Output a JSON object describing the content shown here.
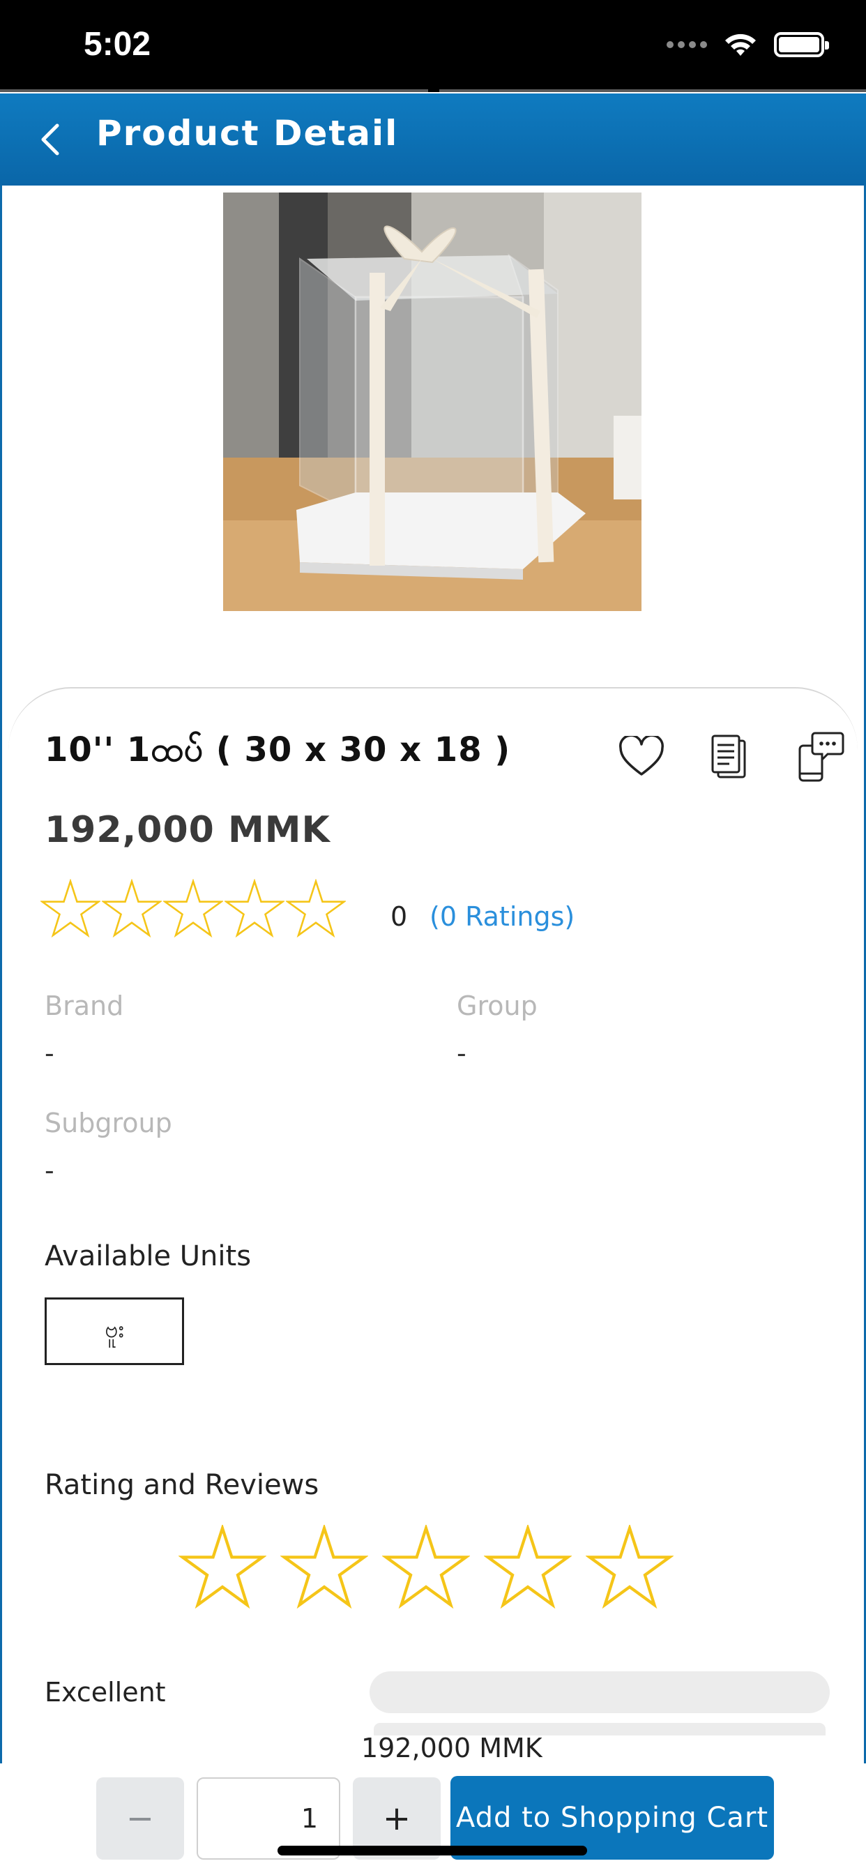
{
  "status_bar": {
    "time": "5:02"
  },
  "header": {
    "title": "Product Detail",
    "back_icon": "chevron-left-icon"
  },
  "product": {
    "name": "10'' 1ထပ် ( 30 x 30 x 18 )",
    "price": "192,000 MMK",
    "image_description_icon": "product-image",
    "rating_value": 0,
    "rating_count": "0",
    "ratings_link": "(0 Ratings)",
    "stars_total": 5
  },
  "actions": {
    "favorite_icon": "heart-icon",
    "document_icon": "document-icon",
    "chat_icon": "chat-phone-icon"
  },
  "attributes": {
    "brand_label": "Brand",
    "brand_value": "-",
    "group_label": "Group",
    "group_value": "-",
    "subgroup_label": "Subgroup",
    "subgroup_value": "-"
  },
  "units": {
    "title": "Available Units",
    "selected": "ဗူး"
  },
  "reviews": {
    "title": "Rating and Reviews",
    "excellent_label": "Excellent",
    "excellent_fraction": 0
  },
  "bottom": {
    "price": "192,000 MMK",
    "minus": "−",
    "quantity": "1",
    "plus": "+",
    "add_to_cart": "Add to Shopping Cart"
  },
  "colors": {
    "header_blue": "#0b6fb3",
    "star_gold": "#f5c518",
    "link_blue": "#2a8fdc",
    "button_blue": "#0b76bb"
  }
}
